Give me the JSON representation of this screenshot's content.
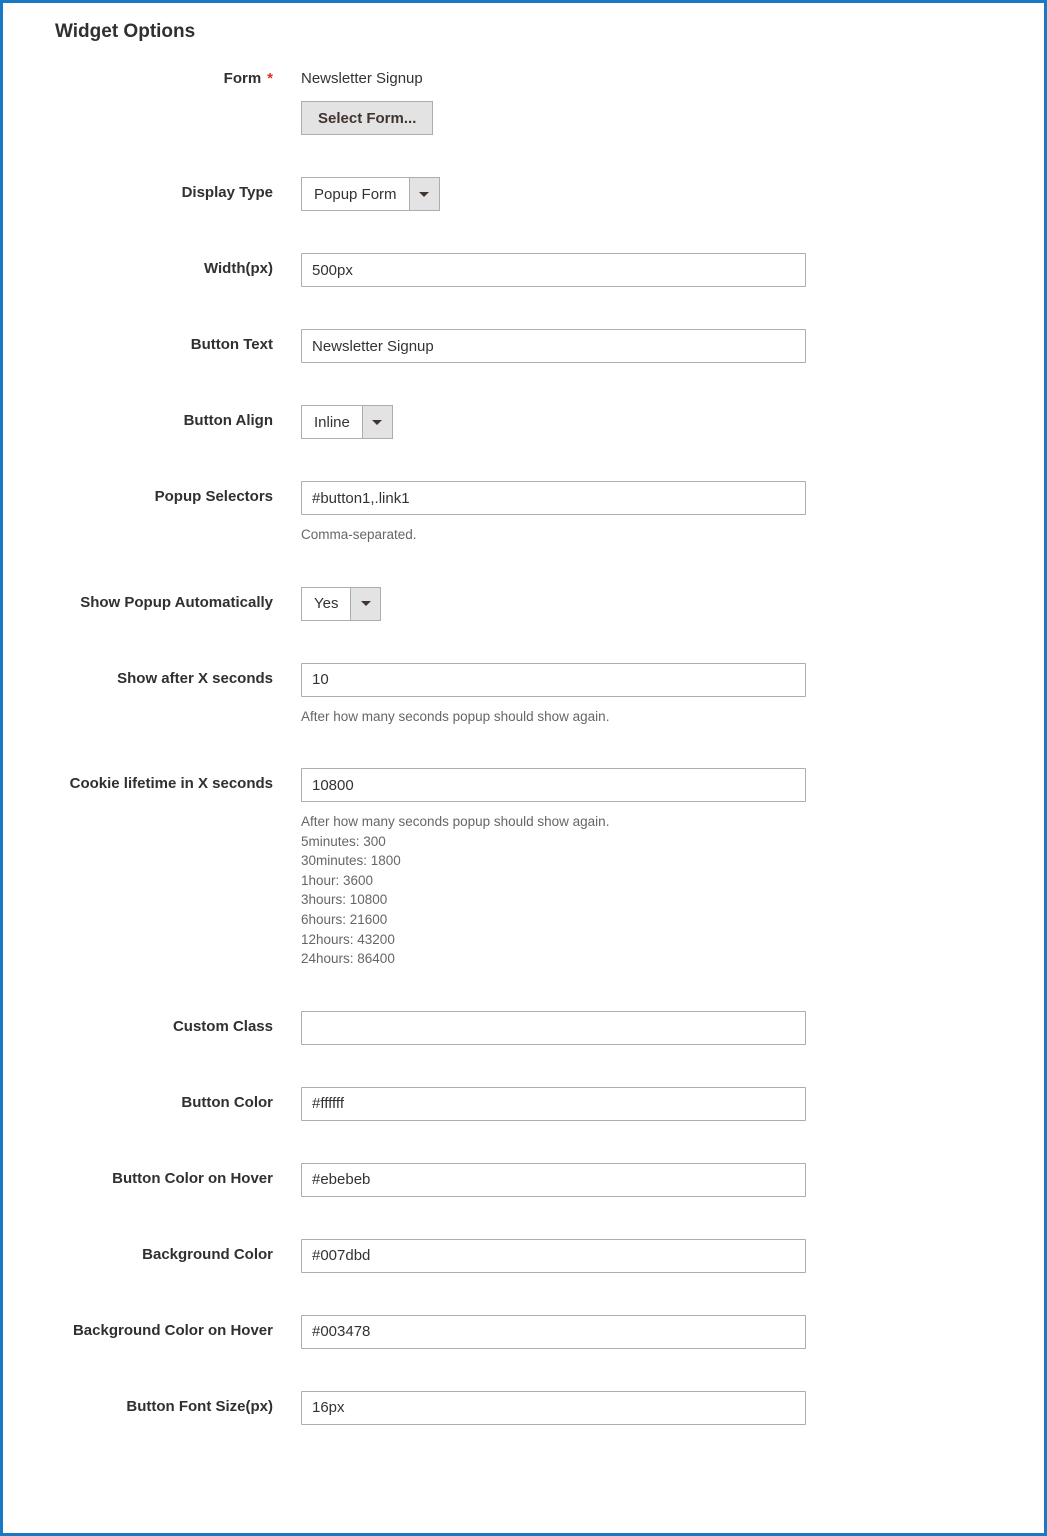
{
  "section_title": "Widget Options",
  "form": {
    "form": {
      "label": "Form",
      "required": true,
      "value": "Newsletter Signup",
      "button_label": "Select Form..."
    },
    "display_type": {
      "label": "Display Type",
      "value": "Popup Form"
    },
    "width": {
      "label": "Width(px)",
      "value": "500px"
    },
    "button_text": {
      "label": "Button Text",
      "value": "Newsletter Signup"
    },
    "button_align": {
      "label": "Button Align",
      "value": "Inline"
    },
    "popup_selectors": {
      "label": "Popup Selectors",
      "value": "#button1,.link1",
      "help": "Comma-separated."
    },
    "show_auto": {
      "label": "Show Popup Automatically",
      "value": "Yes"
    },
    "show_after": {
      "label": "Show after X seconds",
      "value": "10",
      "help": "After how many seconds popup should show again."
    },
    "cookie_lifetime": {
      "label": "Cookie lifetime in X seconds",
      "value": "10800",
      "help": "After how many seconds popup should show again.\n5minutes: 300\n30minutes: 1800\n1hour: 3600\n3hours: 10800\n6hours: 21600\n12hours: 43200\n24hours: 86400"
    },
    "custom_class": {
      "label": "Custom Class",
      "value": ""
    },
    "button_color": {
      "label": "Button Color",
      "value": "#ffffff"
    },
    "button_color_hover": {
      "label": "Button Color on Hover",
      "value": "#ebebeb"
    },
    "background_color": {
      "label": "Background Color",
      "value": "#007dbd"
    },
    "background_color_hover": {
      "label": "Background Color on Hover",
      "value": "#003478"
    },
    "button_font_size": {
      "label": "Button Font Size(px)",
      "value": "16px"
    }
  }
}
